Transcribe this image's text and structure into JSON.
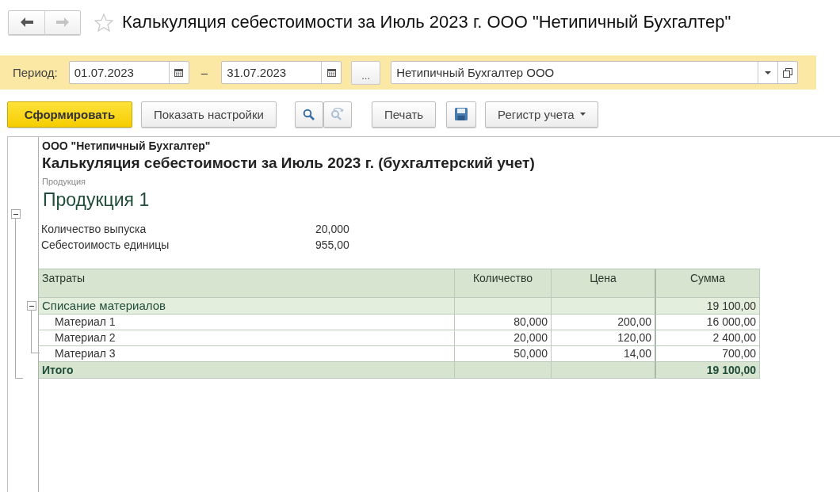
{
  "nav": {
    "back": {
      "disabled": false
    },
    "forward": {
      "disabled": true
    }
  },
  "favorite": false,
  "title": "Калькуляция себестоимости за Июль 2023 г. ООО \"Нетипичный Бухгалтер\"",
  "period": {
    "label": "Период:",
    "from": "01.07.2023",
    "separator": "–",
    "to": "31.07.2023",
    "more_button": "...",
    "organization": "Нетипичный Бухгалтер ООО"
  },
  "toolbar": {
    "generate": "Сформировать",
    "show_settings": "Показать настройки",
    "find_next": {
      "disabled": true
    },
    "print": "Печать",
    "register": "Регистр учета"
  },
  "report": {
    "company": "ООО \"Нетипичный Бухгалтер\"",
    "title": "Калькуляция себестоимости за Июль 2023 г. (бухгалтерский учет)",
    "product_label": "Продукция",
    "product": "Продукция 1",
    "expanded": true,
    "indicators": [
      {
        "label": "Количество выпуска",
        "value": "20,000"
      },
      {
        "label": "Себестоимость единицы",
        "value": "955,00"
      }
    ],
    "columns": [
      "Затраты",
      "Количество",
      "Цена",
      "Сумма"
    ],
    "groups": [
      {
        "name": "Списание материалов",
        "sum": "19 100,00",
        "expanded": true,
        "children": [
          {
            "name": "Материал 1",
            "quantity": "80,000",
            "price": "200,00",
            "sum": "16 000,00"
          },
          {
            "name": "Материал 2",
            "quantity": "20,000",
            "price": "120,00",
            "sum": "2 400,00"
          },
          {
            "name": "Материал 3",
            "quantity": "50,000",
            "price": "14,00",
            "sum": "700,00"
          }
        ]
      }
    ],
    "total": {
      "label": "Итого",
      "sum": "19 100,00"
    }
  }
}
